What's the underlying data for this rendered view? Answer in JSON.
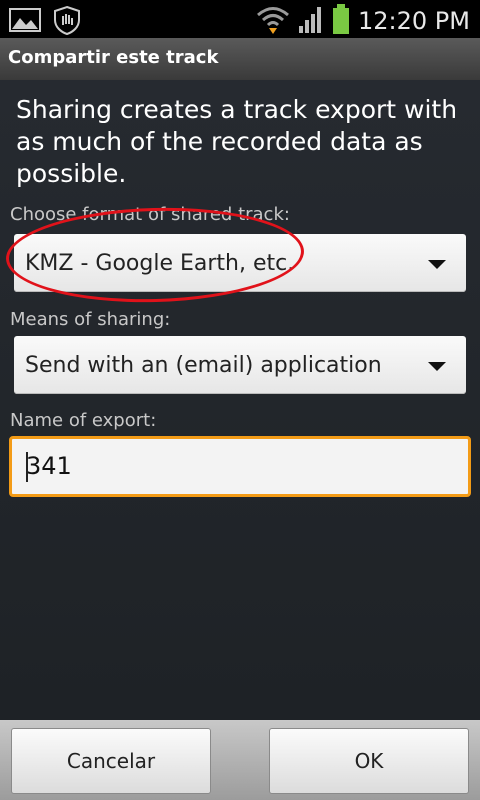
{
  "status_bar": {
    "time": "12:20 PM",
    "icons": [
      "gallery-icon",
      "hand-shield-icon",
      "wifi-icon",
      "signal-icon",
      "battery-icon"
    ]
  },
  "dialog": {
    "title": "Compartir este track",
    "intro": "Sharing creates a track export with as much of the recorded data as possible.",
    "format_label": "Choose format of shared track:",
    "format_value": "KMZ - Google Earth, etc.",
    "sharing_label": "Means of sharing:",
    "sharing_value": "Send with an (email) application",
    "export_label": "Name of export:",
    "export_value": "341"
  },
  "buttons": {
    "cancel": "Cancelar",
    "ok": "OK"
  },
  "colors": {
    "annotation": "#e1121a",
    "focus_border": "#f39b16",
    "battery": "#7ac943"
  }
}
